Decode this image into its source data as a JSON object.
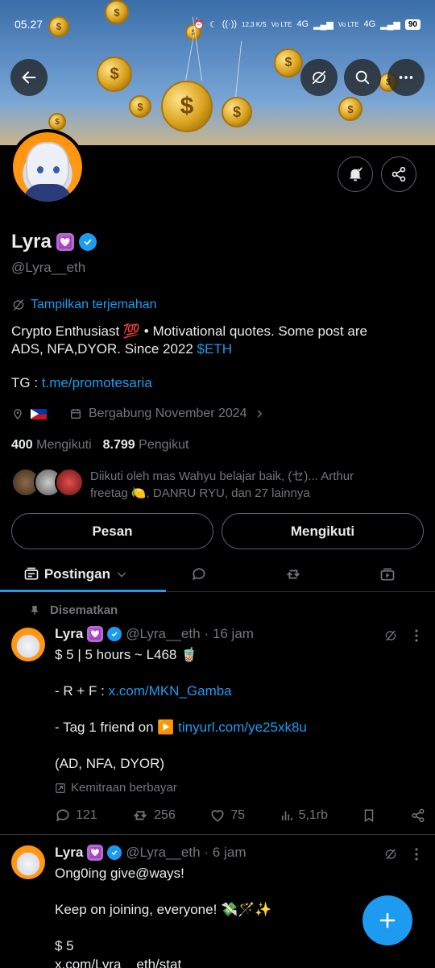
{
  "statusbar": {
    "time": "05.27",
    "battery": "90",
    "speed": "12,3 K/S",
    "net1": "4G",
    "net2": "4G",
    "volte1": "Vo LTE",
    "volte2": "Vo LTE"
  },
  "profile": {
    "name": "Lyra",
    "name_emoji": "💟",
    "handle": "@Lyra__eth",
    "translate": "Tampilkan terjemahan",
    "bio_line1": "Crypto Enthusiast 💯 • Motivational quotes. Some post are",
    "bio_line2": "ADS, NFA,DYOR. Since 2022 ",
    "bio_cashtag": "$ETH",
    "tg_label": "TG : ",
    "tg_link": "t.me/promotesaria",
    "joined": "Bergabung November 2024",
    "following_count": "400",
    "following_label": "Mengikuti",
    "followers_count": "8.799",
    "followers_label": "Pengikut",
    "followed_by_line1": "Diikuti oleh mas Wahyu belajar baik, (セ)... Arthur",
    "followed_by_line2": "freetag 🍋, DANRU RYU, dan 27 lainnya"
  },
  "buttons": {
    "message": "Pesan",
    "following": "Mengikuti"
  },
  "tabs": {
    "posts": "Postingan"
  },
  "pinned_label": "Disematkan",
  "posts": [
    {
      "name": "Lyra",
      "emoji": "💟",
      "handle": "@Lyra__eth",
      "time": "· 16 jam",
      "lines": [
        "$ 5 | 5 hours ~ L468 🧋",
        "- R + F : ",
        "- Tag 1 friend on ▶️ ",
        "(AD, NFA, DYOR)"
      ],
      "link1": "x.com/MKN_Gamba",
      "link2": "tinyurl.com/ye25xk8u",
      "paid": "Kemitraan berbayar",
      "replies": "121",
      "reposts": "256",
      "likes": "75",
      "views": "5,1rb"
    },
    {
      "name": "Lyra",
      "emoji": "💟",
      "handle": "@Lyra__eth",
      "time": "· 6 jam",
      "lines": [
        "Ong0ing give@ways!",
        "Keep on joining, everyone! 💸🪄✨",
        "$ 5"
      ],
      "link1": "x.com/Lyra__eth/stat"
    }
  ],
  "colors": {
    "accent": "#1d9bf0",
    "muted": "#71767b",
    "background": "#000000"
  }
}
